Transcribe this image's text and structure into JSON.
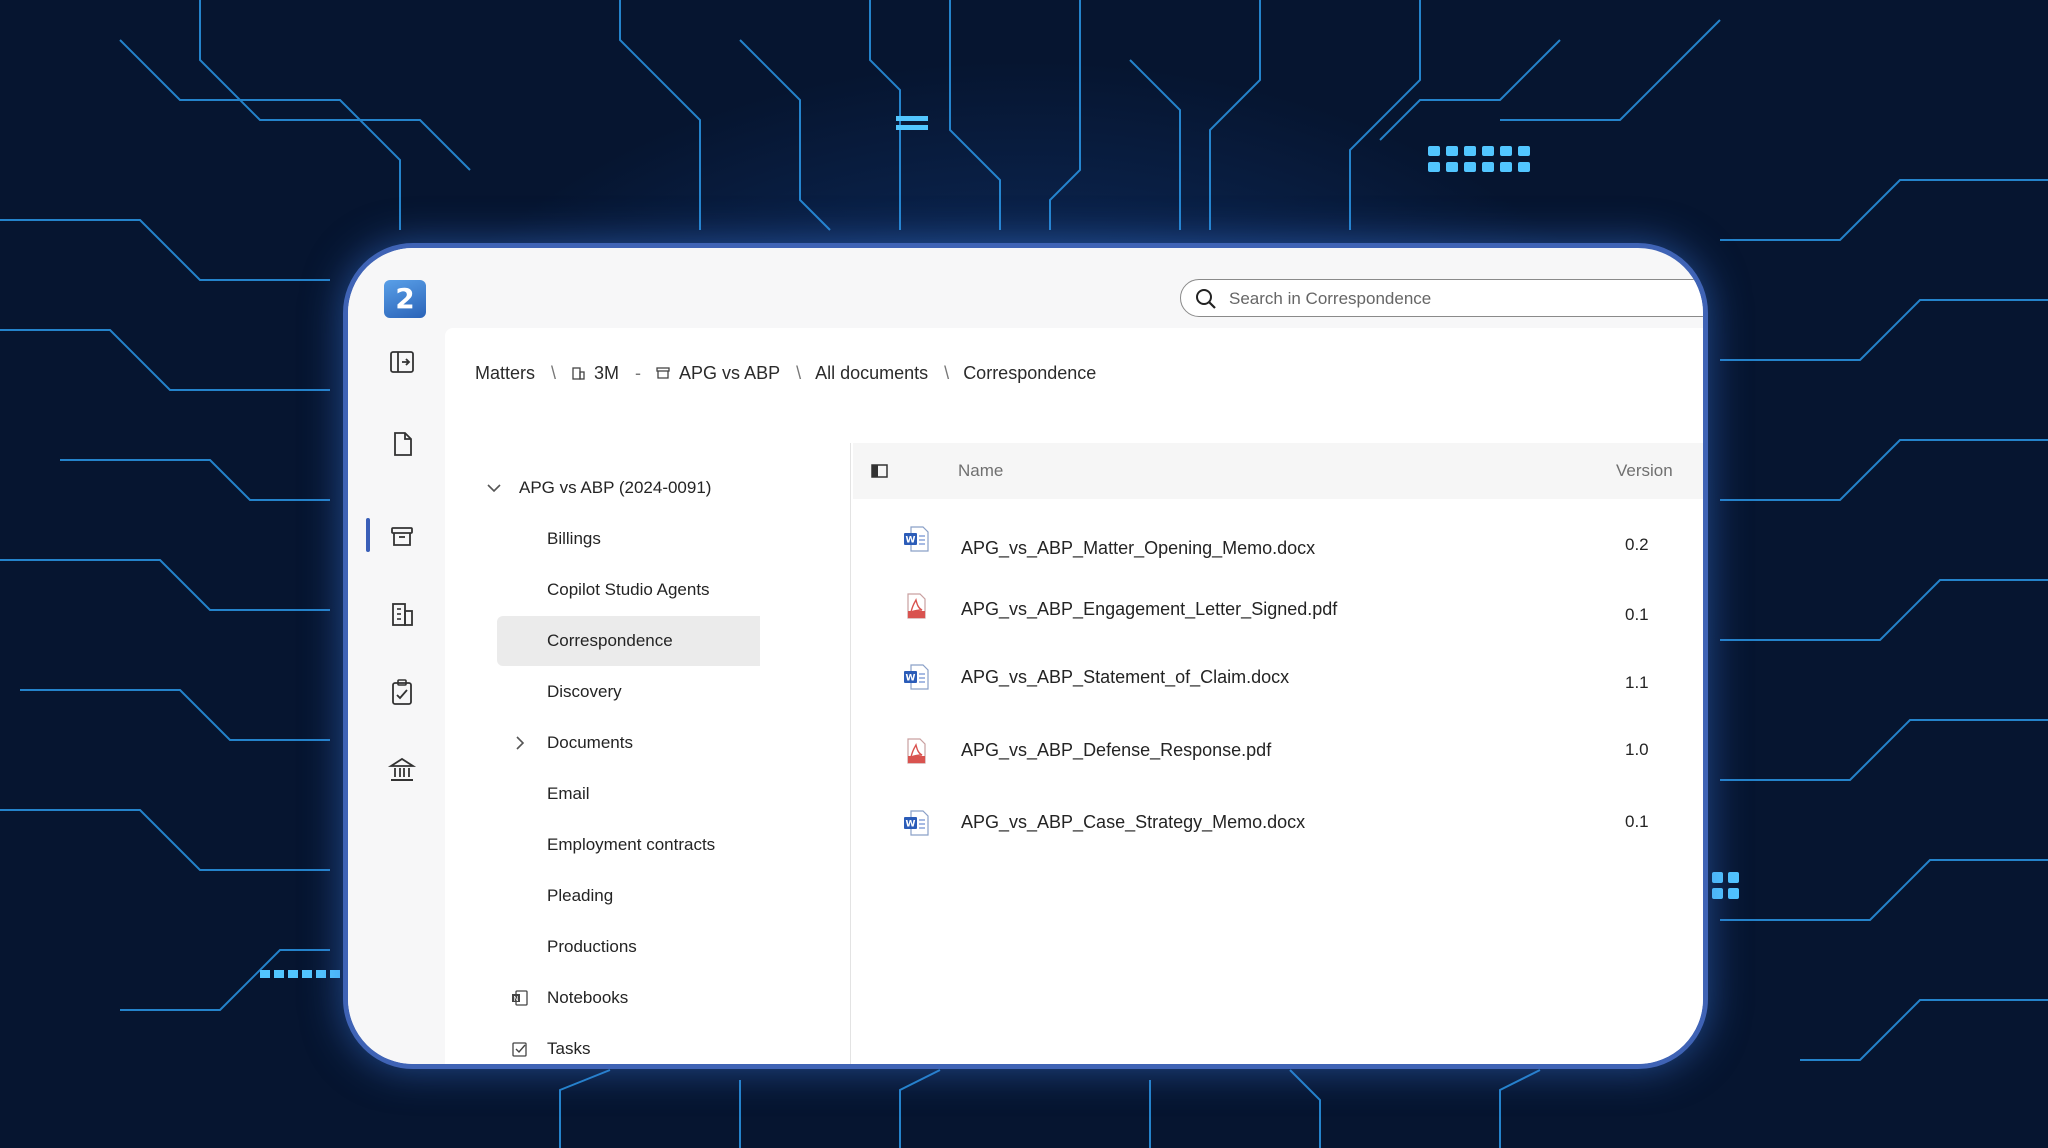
{
  "window": {
    "logo_text": "2",
    "search": {
      "placeholder": "Search in Correspondence"
    }
  },
  "rail": {
    "items": [
      {
        "icon": "expand-panel-icon"
      },
      {
        "icon": "document-icon"
      },
      {
        "icon": "archive-icon",
        "active": true
      },
      {
        "icon": "building-icon"
      },
      {
        "icon": "clipboard-icon"
      },
      {
        "icon": "bank-icon"
      }
    ]
  },
  "breadcrumb": {
    "items": [
      {
        "label": "Matters",
        "sep": "\\"
      },
      {
        "label": "3M",
        "icon": "client-icon",
        "sep": "-"
      },
      {
        "label": "APG vs ABP",
        "icon": "matter-icon",
        "sep": "\\"
      },
      {
        "label": "All documents",
        "sep": "\\"
      },
      {
        "label": "Correspondence"
      }
    ]
  },
  "tree": {
    "root": "APG vs ABP (2024-0091)",
    "items": [
      {
        "label": "Billings"
      },
      {
        "label": "Copilot Studio Agents"
      },
      {
        "label": "Correspondence",
        "selected": true
      },
      {
        "label": "Discovery"
      },
      {
        "label": "Documents",
        "expandable": true
      },
      {
        "label": "Email"
      },
      {
        "label": "Employment contracts"
      },
      {
        "label": "Pleading"
      },
      {
        "label": "Productions"
      },
      {
        "label": "Notebooks",
        "icon": "onenote-icon"
      },
      {
        "label": "Tasks",
        "icon": "tasks-icon"
      }
    ]
  },
  "list": {
    "columns": {
      "name": "Name",
      "version": "Version"
    },
    "rows": [
      {
        "name": "APG_vs_ABP_Matter_Opening_Memo.docx",
        "type": "word",
        "version": "0.2"
      },
      {
        "name": "APG_vs_ABP_Engagement_Letter_Signed.pdf",
        "type": "pdf",
        "version": "0.1"
      },
      {
        "name": "APG_vs_ABP_Statement_of_Claim.docx",
        "type": "word",
        "version": "1.1"
      },
      {
        "name": "APG_vs_ABP_Defense_Response.pdf",
        "type": "pdf",
        "version": "1.0"
      },
      {
        "name": "APG_vs_ABP_Case_Strategy_Memo.docx",
        "type": "word",
        "version": "0.1"
      }
    ]
  },
  "colors": {
    "accent": "#3f63b5",
    "word": "#2b5cb8",
    "pdf": "#d9534f",
    "selected_bg": "#ebebeb"
  }
}
